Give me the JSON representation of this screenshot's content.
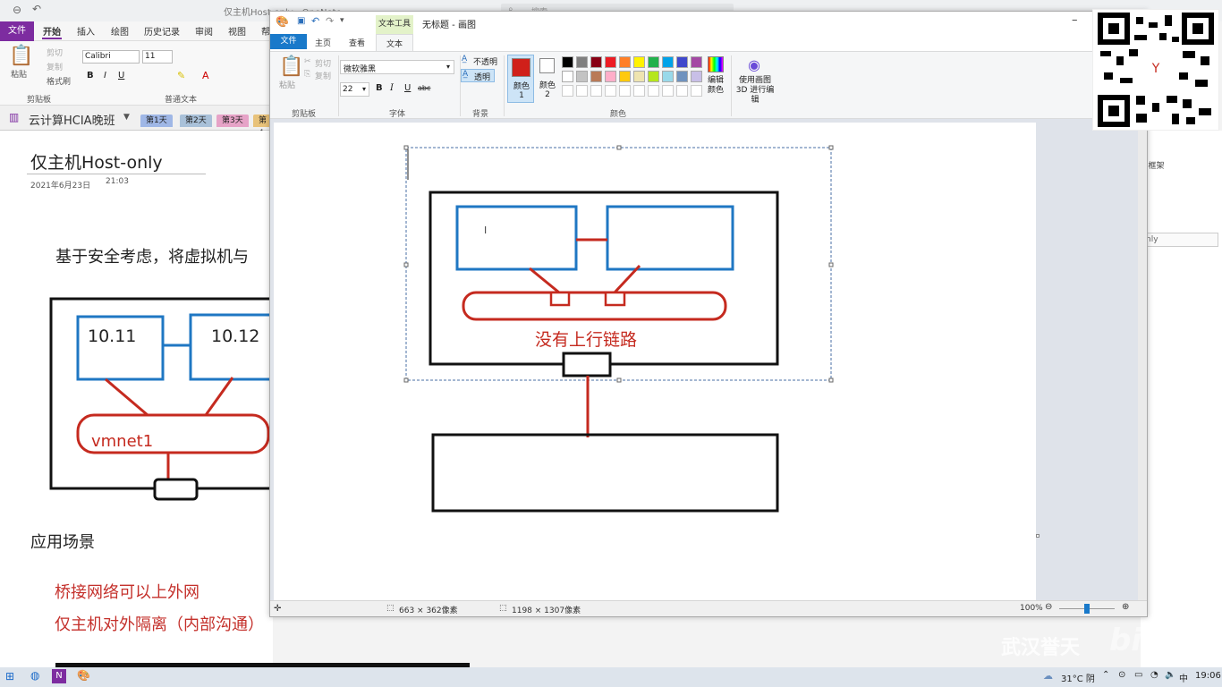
{
  "onenote": {
    "window_title": "仅主机Host-only  -  OneNote",
    "search_placeholder": "搜索",
    "tabs": [
      "文件",
      "开始",
      "插入",
      "绘图",
      "历史记录",
      "审阅",
      "视图",
      "帮"
    ],
    "clipboard": {
      "paste": "粘贴",
      "cut": "剪切",
      "copy": "复制",
      "format_painter": "格式刷",
      "group": "剪贴板"
    },
    "font": {
      "name": "Calibri",
      "size": "11",
      "group": "普通文本"
    },
    "notebook": "云计算HCIA晚班",
    "sections": [
      "第1天",
      "第2天",
      "第3天",
      "第4"
    ],
    "page_title": "仅主机Host-only",
    "date": "2021年6月23日",
    "time": "21:03",
    "line1": "基于安全考虑，将虚拟机与",
    "ip1": "10.11",
    "ip2": "10.12",
    "vmnet": "vmnet1",
    "heading2": "应用场景",
    "bullet1": "桥接网络可以上外网",
    "bullet2": "仅主机对外隔离（内部沟通）",
    "right_pane": {
      "label": "e框架",
      "item": "nly"
    }
  },
  "paint": {
    "tool_tab": "文本工具",
    "title": "无标题 - 画图",
    "tabs": {
      "file": "文件",
      "home": "主页",
      "view": "查看",
      "text": "文本"
    },
    "clipboard": {
      "paste": "粘贴",
      "cut": "剪切",
      "copy": "复制",
      "group": "剪贴板"
    },
    "font": {
      "name": "微软雅黑",
      "size": "22",
      "group": "字体",
      "bold": "B",
      "italic": "I",
      "underline": "U",
      "strike": "abc"
    },
    "background": {
      "opaque": "不透明",
      "transparent": "透明",
      "group": "背景"
    },
    "colors": {
      "color1": "颜色 1",
      "color2": "颜色 2",
      "edit": "编辑颜色",
      "group": "颜色",
      "color1_value": "#d0201a",
      "color2_value": "#ffffff",
      "palette_row1": [
        "#000000",
        "#7f7f7f",
        "#880015",
        "#ed1c24",
        "#ff7f27",
        "#fff200",
        "#22b14c",
        "#00a2e8",
        "#3f48cc",
        "#a349a4"
      ],
      "palette_row2": [
        "#ffffff",
        "#c3c3c3",
        "#b97a57",
        "#ffaec9",
        "#ffc90e",
        "#efe4b0",
        "#b5e61d",
        "#99d9ea",
        "#7092be",
        "#c8bfe7"
      ]
    },
    "paint3d": "使用画图 3D 进行编辑",
    "canvas_text": "没有上行链路",
    "status": {
      "selection": "663 × 362像素",
      "canvas": "1198 × 1307像素",
      "zoom": "100%"
    }
  },
  "taskbar": {
    "weather": "31°C 阴",
    "ime": "中",
    "time": "19:06"
  },
  "watermark": {
    "text": "武汉誉天",
    "logo": "bilibili"
  }
}
